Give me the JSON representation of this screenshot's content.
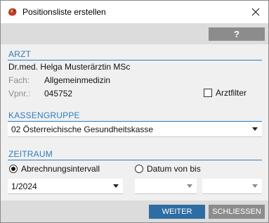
{
  "window": {
    "title": "Positionsliste erstellen",
    "help_label": "?"
  },
  "arzt": {
    "heading": "ARZT",
    "name": "Dr.med. Helga Musterärztin MSc",
    "fach_label": "Fach:",
    "fach_value": "Allgemeinmedizin",
    "vpnr_label": "Vpnr.:",
    "vpnr_value": "045752",
    "arztfilter_label": "Arztfilter",
    "arztfilter_checked": false
  },
  "kassengruppe": {
    "heading": "KASSENGRUPPE",
    "selected": "02 Österreichische Gesundheitskasse"
  },
  "zeitraum": {
    "heading": "ZEITRAUM",
    "option_interval_label": "Abrechnungsintervall",
    "option_range_label": "Datum von bis",
    "selected_option": "Abrechnungsintervall",
    "interval_value": "1/2024",
    "date_from": "",
    "date_to": ""
  },
  "footer": {
    "weiter_label": "WEITER",
    "schliessen_label": "SCHLIESSEN"
  },
  "colors": {
    "accent": "#2d7dc0",
    "primary_button": "#2d6da3",
    "secondary_button": "#8c8c8c"
  }
}
